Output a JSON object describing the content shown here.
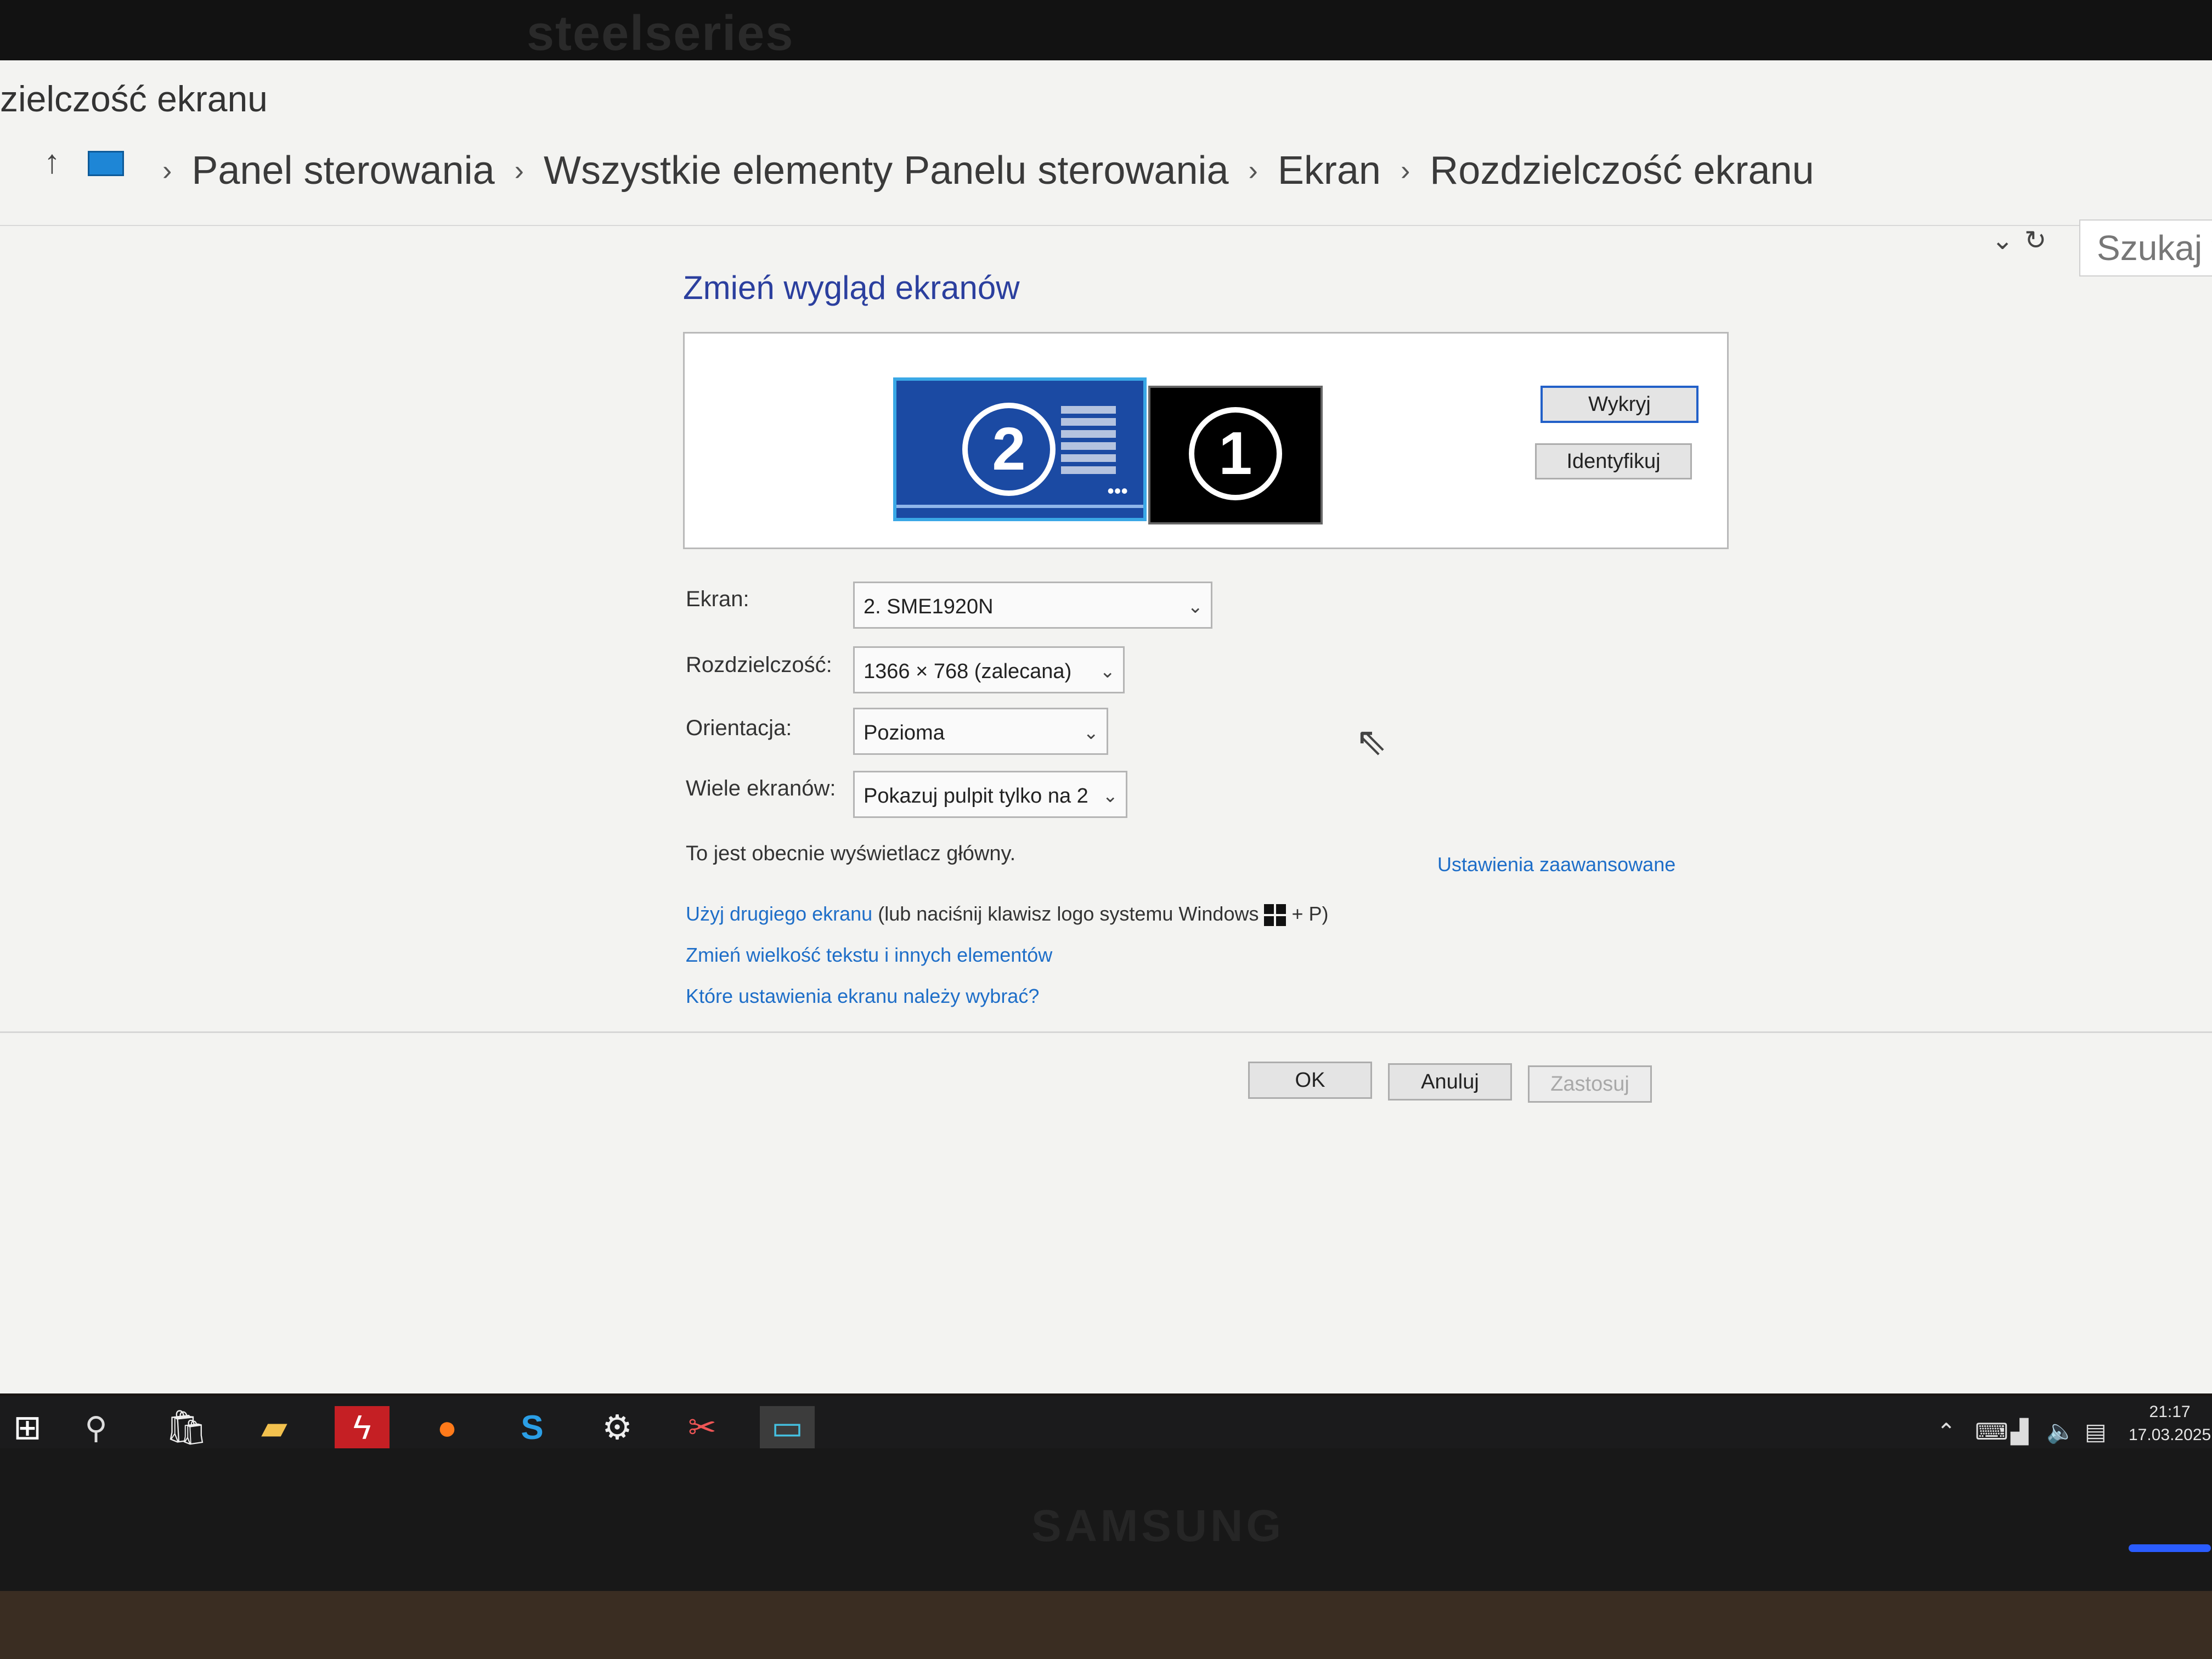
{
  "monitor": {
    "brand_top": "steelseries",
    "brand_bottom": "SAMSUNG"
  },
  "window": {
    "title": "zielczość ekranu",
    "breadcrumb": [
      "Panel sterowania",
      "Wszystkie elementy Panelu sterowania",
      "Ekran",
      "Rozdzielczość ekranu"
    ],
    "breadcrumb_sep": "›",
    "search_placeholder": "Szukaj w"
  },
  "main": {
    "heading": "Zmień wygląd ekranów",
    "monitors": [
      {
        "number": "2",
        "selected": true
      },
      {
        "number": "1",
        "selected": false
      }
    ],
    "detect_button": "Wykryj",
    "identify_button": "Identyfikuj",
    "fields": {
      "display": {
        "label": "Ekran:",
        "value": "2. SME1920N"
      },
      "resolution": {
        "label": "Rozdzielczość:",
        "value": "1366 × 768 (zalecana)"
      },
      "orientation": {
        "label": "Orientacja:",
        "value": "Pozioma"
      },
      "multiple": {
        "label": "Wiele ekranów:",
        "value": "Pokazuj pulpit tylko na 2"
      }
    },
    "primary_note": "To jest obecnie wyświetlacz główny.",
    "advanced_link": "Ustawienia zaawansowane",
    "link_second_screen": "Użyj drugiego ekranu",
    "second_screen_hint": "(lub naciśnij klawisz logo systemu Windows",
    "second_screen_keys": "+ P)",
    "link_text_size": "Zmień wielkość tekstu i innych elementów",
    "link_which_settings": "Które ustawienia ekranu należy wybrać?",
    "ok_button": "OK",
    "cancel_button": "Anuluj",
    "apply_button": "Zastosuj"
  },
  "taskbar": {
    "time": "21:17",
    "date": "17.03.2025"
  },
  "colors": {
    "accent": "#1e6ec8",
    "heading": "#2b3f9e",
    "taskbar": "#1b1b1c"
  }
}
